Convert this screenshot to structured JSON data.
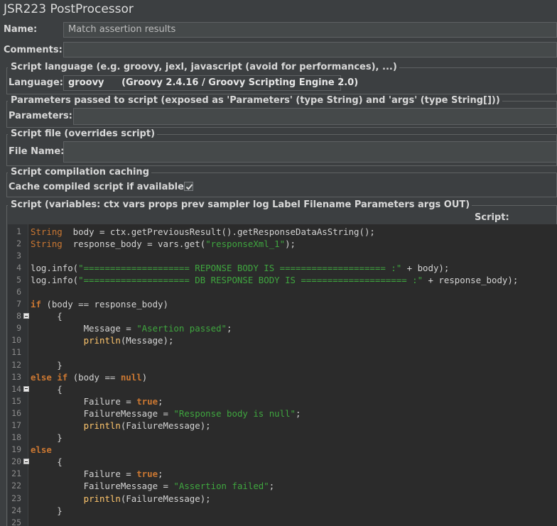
{
  "window_title": "JSR223 PostProcessor",
  "name_label": "Name:",
  "name_value": "Match assertion results",
  "comments_label": "Comments:",
  "comments_value": "",
  "language_group": {
    "title": "Script language (e.g. groovy, jexl, javascript (avoid for performances), ...)",
    "label": "Language:",
    "value": "groovy",
    "engine": "(Groovy 2.4.16 / Groovy Scripting Engine 2.0)"
  },
  "parameters_group": {
    "title": "Parameters passed to script (exposed as 'Parameters' (type String) and 'args' (type String[]))",
    "label": "Parameters:",
    "value": ""
  },
  "script_file_group": {
    "title": "Script file (overrides script)",
    "label": "File Name:",
    "value": ""
  },
  "caching_group": {
    "title": "Script compilation caching",
    "label": "Cache compiled script if available:",
    "checked": true
  },
  "script_group": {
    "title": "Script (variables: ctx vars props prev sampler log Label Filename Parameters args OUT)",
    "header": "Script:"
  },
  "code_lines": [
    {
      "n": "1",
      "fold": false,
      "tokens": [
        [
          "ty",
          "String"
        ],
        [
          "",
          "  body = ctx.getPreviousResult().getResponseDataAsString();"
        ]
      ]
    },
    {
      "n": "2",
      "fold": false,
      "tokens": [
        [
          "ty",
          "String"
        ],
        [
          "",
          "  response_body = vars.get("
        ],
        [
          "str",
          "\"responseXml_1\""
        ],
        [
          "",
          ");"
        ]
      ]
    },
    {
      "n": "3",
      "fold": false,
      "tokens": []
    },
    {
      "n": "4",
      "fold": false,
      "tokens": [
        [
          "",
          "log.info("
        ],
        [
          "str",
          "\"==================== REPONSE BODY IS ==================== :\""
        ],
        [
          "",
          " + body);"
        ]
      ]
    },
    {
      "n": "5",
      "fold": false,
      "tokens": [
        [
          "",
          "log.info("
        ],
        [
          "str",
          "\"==================== DB RESPONSE BODY IS ==================== :\""
        ],
        [
          "",
          " + response_body);"
        ]
      ]
    },
    {
      "n": "6",
      "fold": false,
      "tokens": []
    },
    {
      "n": "7",
      "fold": false,
      "tokens": [
        [
          "kw",
          "if"
        ],
        [
          "",
          " (body == response_body)"
        ]
      ]
    },
    {
      "n": "8",
      "fold": true,
      "tokens": [
        [
          "",
          "     {"
        ]
      ]
    },
    {
      "n": "9",
      "fold": false,
      "tokens": [
        [
          "",
          "          Message = "
        ],
        [
          "str",
          "\"Asertion passed\""
        ],
        [
          "",
          ";"
        ]
      ]
    },
    {
      "n": "10",
      "fold": false,
      "tokens": [
        [
          "",
          "          "
        ],
        [
          "fn",
          "println"
        ],
        [
          "",
          "(Message);"
        ]
      ]
    },
    {
      "n": "11",
      "fold": false,
      "tokens": []
    },
    {
      "n": "12",
      "fold": false,
      "tokens": [
        [
          "",
          "     }"
        ]
      ]
    },
    {
      "n": "13",
      "fold": false,
      "tokens": [
        [
          "kw",
          "else"
        ],
        [
          "",
          " "
        ],
        [
          "kw",
          "if"
        ],
        [
          "",
          " (body == "
        ],
        [
          "kw",
          "null"
        ],
        [
          "",
          ")"
        ]
      ]
    },
    {
      "n": "14",
      "fold": true,
      "tokens": [
        [
          "",
          "     {"
        ]
      ]
    },
    {
      "n": "15",
      "fold": false,
      "tokens": [
        [
          "",
          "          Failure = "
        ],
        [
          "kw",
          "true"
        ],
        [
          "",
          ";"
        ]
      ]
    },
    {
      "n": "16",
      "fold": false,
      "tokens": [
        [
          "",
          "          FailureMessage = "
        ],
        [
          "str",
          "\"Response body is null\""
        ],
        [
          "",
          ";"
        ]
      ]
    },
    {
      "n": "17",
      "fold": false,
      "tokens": [
        [
          "",
          "          "
        ],
        [
          "fn",
          "println"
        ],
        [
          "",
          "(FailureMessage);"
        ]
      ]
    },
    {
      "n": "18",
      "fold": false,
      "tokens": [
        [
          "",
          "     }"
        ]
      ]
    },
    {
      "n": "19",
      "fold": false,
      "tokens": [
        [
          "kw",
          "else"
        ]
      ]
    },
    {
      "n": "20",
      "fold": true,
      "tokens": [
        [
          "",
          "     {"
        ]
      ]
    },
    {
      "n": "21",
      "fold": false,
      "tokens": [
        [
          "",
          "          Failure = "
        ],
        [
          "kw",
          "true"
        ],
        [
          "",
          ";"
        ]
      ]
    },
    {
      "n": "22",
      "fold": false,
      "tokens": [
        [
          "",
          "          FailureMessage = "
        ],
        [
          "str",
          "\"Assertion failed\""
        ],
        [
          "",
          ";"
        ]
      ]
    },
    {
      "n": "23",
      "fold": false,
      "tokens": [
        [
          "",
          "          "
        ],
        [
          "fn",
          "println"
        ],
        [
          "",
          "(FailureMessage);"
        ]
      ]
    },
    {
      "n": "24",
      "fold": false,
      "tokens": [
        [
          "",
          "     }"
        ]
      ]
    },
    {
      "n": "25",
      "fold": false,
      "tokens": []
    }
  ],
  "colors": {
    "background": "#3c3f41",
    "editor_background": "#2b2b2b",
    "keyword": "#cc7832",
    "string": "#3fa63f",
    "method": "#ffc66d"
  }
}
